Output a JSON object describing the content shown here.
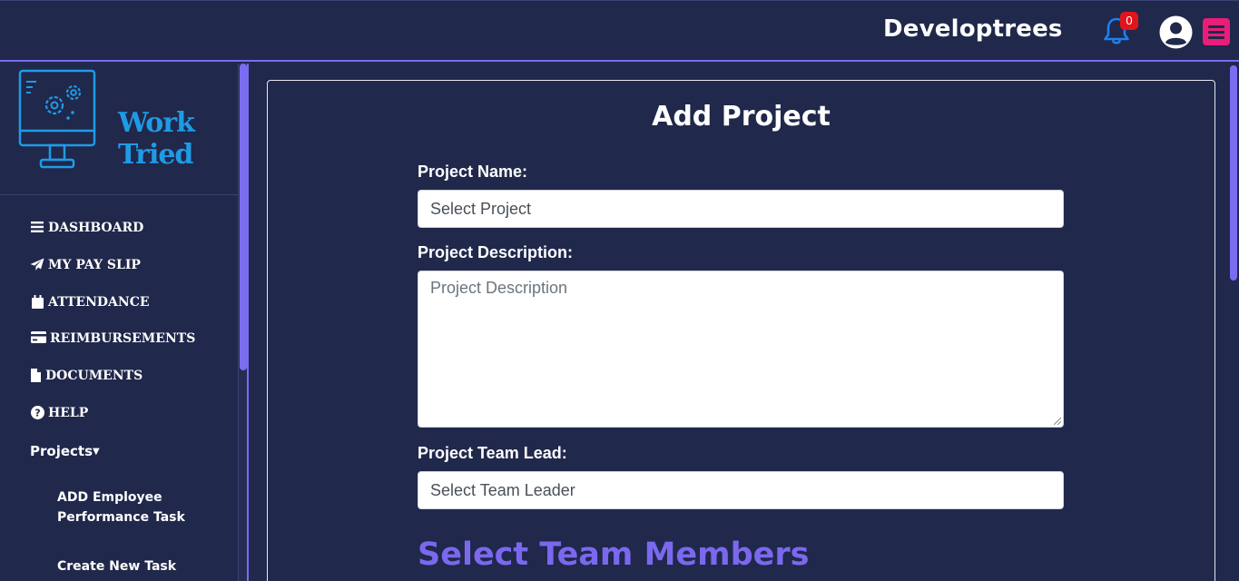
{
  "header": {
    "brand": "Developtrees",
    "notification_count": "0",
    "icons": {
      "bell": "bell-icon",
      "profile": "user-circle-icon",
      "menu": "hamburger-icon"
    },
    "colors": {
      "accent": "#7b6cf0",
      "bell": "#1f7ff0",
      "badge": "#e0151b",
      "menu": "#e81e78",
      "background": "#20284b"
    }
  },
  "sidebar": {
    "logo_text": "Work Tried",
    "items": [
      {
        "label": "DASHBOARD",
        "icon": "bars-icon"
      },
      {
        "label": "MY PAY SLIP",
        "icon": "paper-plane-icon"
      },
      {
        "label": "ATTENDANCE",
        "icon": "calendar-icon"
      },
      {
        "label": "REIMBURSEMENTS",
        "icon": "credit-card-icon"
      },
      {
        "label": "DOCUMENTS",
        "icon": "file-icon"
      },
      {
        "label": "HELP",
        "icon": "question-circle-icon"
      }
    ],
    "projects_label": "Projects",
    "projects_sub": [
      {
        "label": "ADD Employee Performance Task"
      },
      {
        "label": "Create New Task"
      }
    ]
  },
  "form": {
    "title": "Add Project",
    "project_name_label": "Project Name:",
    "project_name_value": "Select Project",
    "description_label": "Project Description:",
    "description_placeholder": "Project Description",
    "team_lead_label": "Project Team Lead:",
    "team_lead_value": "Select Team Leader",
    "members_title": "Select Team Members"
  }
}
